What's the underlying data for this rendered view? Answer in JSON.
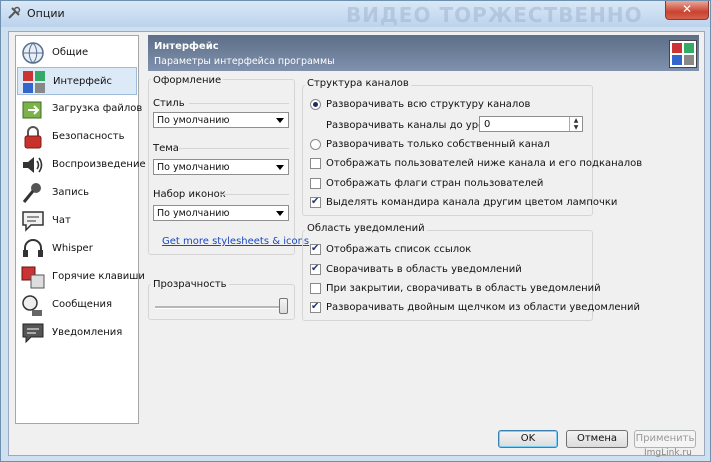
{
  "window": {
    "title": "Опции",
    "watermark": "ВИДЕО ТОРЖЕСТВЕННО",
    "close_glyph": "✕"
  },
  "sidebar": {
    "items": [
      {
        "label": "Общие",
        "icon": "globe-icon",
        "selected": false
      },
      {
        "label": "Интерфейс",
        "icon": "palette-icon",
        "selected": true
      },
      {
        "label": "Загрузка файлов",
        "icon": "file-transfer-icon",
        "selected": false
      },
      {
        "label": "Безопасность",
        "icon": "lock-icon",
        "selected": false
      },
      {
        "label": "Воспроизведение",
        "icon": "speaker-icon",
        "selected": false
      },
      {
        "label": "Запись",
        "icon": "microphone-icon",
        "selected": false
      },
      {
        "label": "Чат",
        "icon": "chat-icon",
        "selected": false
      },
      {
        "label": "Whisper",
        "icon": "headset-icon",
        "selected": false
      },
      {
        "label": "Горячие клавиши",
        "icon": "hotkeys-icon",
        "selected": false
      },
      {
        "label": "Сообщения",
        "icon": "messages-icon",
        "selected": false
      },
      {
        "label": "Уведомления",
        "icon": "notifications-icon",
        "selected": false
      }
    ]
  },
  "header": {
    "title": "Интерфейс",
    "subtitle": "Параметры интерфейса программы"
  },
  "design": {
    "group_label": "Оформление",
    "style_label": "Стиль",
    "style_value": "По умолчанию",
    "theme_label": "Тема",
    "theme_value": "По умолчанию",
    "iconset_label": "Набор иконок",
    "iconset_value": "По умолчанию",
    "link": "Get more stylesheets & icons"
  },
  "transparency": {
    "label": "Прозрачность",
    "level": 1.0
  },
  "channels": {
    "group_label": "Структура каналов",
    "expand_all": {
      "label": "Разворачивать всю структуру каналов",
      "checked": true
    },
    "depth_label": "Разворачивать каналы до уровня:",
    "depth_value": "0",
    "expand_own": {
      "label": "Разворачивать только собственный канал",
      "checked": false
    },
    "show_users_below": {
      "label": "Отображать пользователей ниже канала и его подканалов",
      "checked": false
    },
    "show_flags": {
      "label": "Отображать флаги стран пользователей",
      "checked": false
    },
    "highlight_commander": {
      "label": "Выделять командира канала другим цветом лампочки",
      "checked": true
    }
  },
  "tray": {
    "group_label": "Область уведомлений",
    "show_links": {
      "label": "Отображать список ссылок",
      "checked": true
    },
    "minimize_to_tray": {
      "label": "Сворачивать в область уведомлений",
      "checked": true
    },
    "close_to_tray": {
      "label": "При закрытии, сворачивать в область уведомлений",
      "checked": false
    },
    "restore_dblclick": {
      "label": "Разворачивать двойным щелчком из области уведомлений",
      "checked": true
    }
  },
  "buttons": {
    "ok": "OK",
    "cancel": "Отмена",
    "apply": "Применить"
  },
  "footer": {
    "watermark": "ImgLink.ru"
  },
  "colors": {
    "header_bg": "#6b7d99",
    "selected_bg": "#dce9f7",
    "link": "#1b47c4",
    "close_red": "#c9432f"
  }
}
